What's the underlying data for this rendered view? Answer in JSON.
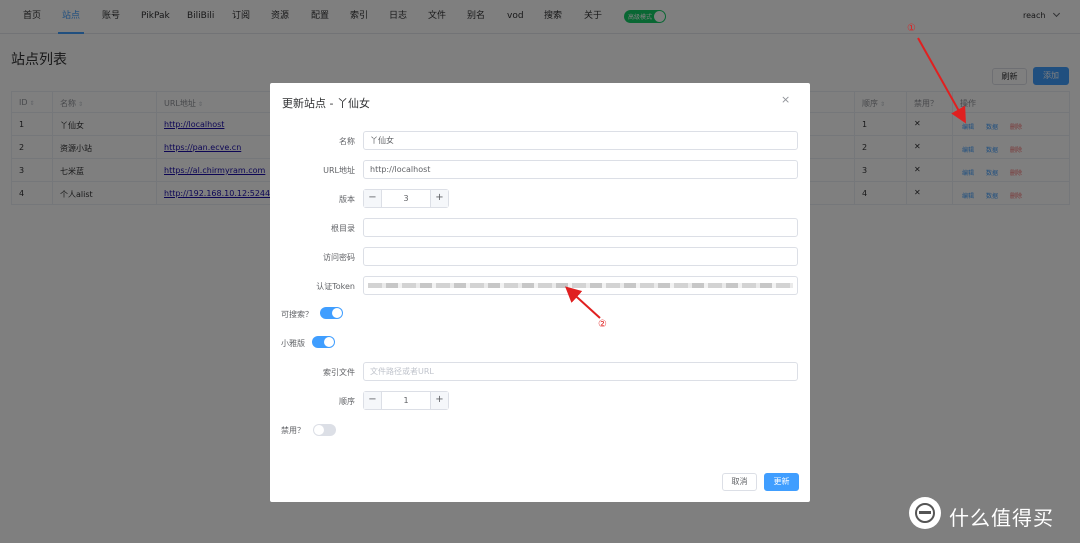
{
  "nav": {
    "items": [
      "首页",
      "站点",
      "账号",
      "PikPak",
      "BiliBili",
      "订阅",
      "资源",
      "配置",
      "索引",
      "日志",
      "文件",
      "别名",
      "vod",
      "搜索",
      "关于"
    ],
    "active_index": 1,
    "mode_toggle_label": "高级模式",
    "user": "reach"
  },
  "page": {
    "title": "站点列表",
    "refresh_label": "刷新",
    "add_label": "添加"
  },
  "table": {
    "headers": [
      "ID",
      "名称",
      "URL地址",
      "顺序",
      "禁用？",
      "操作"
    ],
    "rows": [
      {
        "id": "1",
        "name": "丫仙女",
        "url": "http://localhost",
        "order": "1",
        "disabled": "✕"
      },
      {
        "id": "2",
        "name": "资源小站",
        "url": "https://pan.ecve.cn",
        "order": "2",
        "disabled": "✕"
      },
      {
        "id": "3",
        "name": "七米蓝",
        "url": "https://al.chirmyram.com",
        "order": "3",
        "disabled": "✕"
      },
      {
        "id": "4",
        "name": "个人alist",
        "url": "http://192.168.10.12:5244",
        "order": "4",
        "disabled": "✕"
      }
    ],
    "actions": {
      "edit": "编辑",
      "data": "数据",
      "delete": "删除"
    }
  },
  "dialog": {
    "title": "更新站点 - 丫仙女",
    "close_glyph": "×",
    "fields": {
      "name_label": "名称",
      "name_value": "丫仙女",
      "url_label": "URL地址",
      "url_value": "http://localhost",
      "version_label": "版本",
      "version_value": "3",
      "root_label": "根目录",
      "root_value": "",
      "password_label": "访问密码",
      "password_value": "",
      "token_label": "认证Token",
      "searchable_label": "可搜索？",
      "searchable": true,
      "xiaoya_label": "小雅版",
      "xiaoya": true,
      "index_label": "索引文件",
      "index_placeholder": "文件路径或者URL",
      "order_label": "顺序",
      "order_value": "1",
      "disabled_label": "禁用？",
      "disabled": false
    },
    "minus_glyph": "−",
    "plus_glyph": "+",
    "cancel_label": "取消",
    "update_label": "更新"
  },
  "annotations": {
    "one": "①",
    "two": "②",
    "color": "#e02020"
  },
  "watermark": {
    "text": "什么值得买"
  }
}
